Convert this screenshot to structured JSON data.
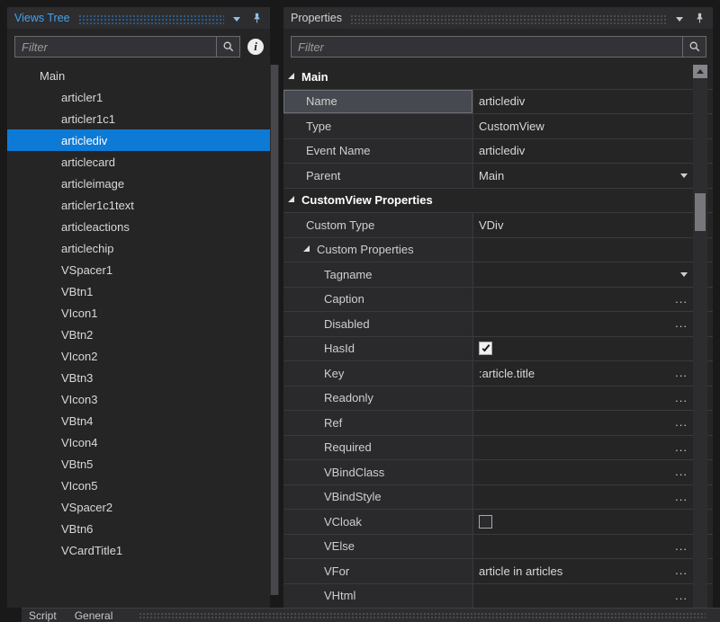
{
  "glyphs": {
    "ellipsis": "..."
  },
  "colors": {
    "selection_blue": "#0d7ad6",
    "active_title_blue": "#42a3ea",
    "panel_background": "#252526"
  },
  "views_tree": {
    "title": "Views Tree",
    "filter_placeholder": "Filter",
    "items": [
      {
        "label": "Main",
        "level": 0
      },
      {
        "label": "articler1",
        "level": 1
      },
      {
        "label": "articler1c1",
        "level": 1
      },
      {
        "label": "articlediv",
        "level": 1,
        "selected": true
      },
      {
        "label": "articlecard",
        "level": 1
      },
      {
        "label": "articleimage",
        "level": 1
      },
      {
        "label": "articler1c1text",
        "level": 1
      },
      {
        "label": "articleactions",
        "level": 1
      },
      {
        "label": "articlechip",
        "level": 1
      },
      {
        "label": "VSpacer1",
        "level": 1
      },
      {
        "label": "VBtn1",
        "level": 1
      },
      {
        "label": "VIcon1",
        "level": 1
      },
      {
        "label": "VBtn2",
        "level": 1
      },
      {
        "label": "VIcon2",
        "level": 1
      },
      {
        "label": "VBtn3",
        "level": 1
      },
      {
        "label": "VIcon3",
        "level": 1
      },
      {
        "label": "VBtn4",
        "level": 1
      },
      {
        "label": "VIcon4",
        "level": 1
      },
      {
        "label": "VBtn5",
        "level": 1
      },
      {
        "label": "VIcon5",
        "level": 1
      },
      {
        "label": "VSpacer2",
        "level": 1
      },
      {
        "label": "VBtn6",
        "level": 1
      },
      {
        "label": "VCardTitle1",
        "level": 1
      }
    ]
  },
  "properties": {
    "title": "Properties",
    "filter_placeholder": "Filter",
    "rows": [
      {
        "kind": "section",
        "label": "Main",
        "level": 0
      },
      {
        "kind": "prop",
        "label": "Name",
        "value": "articlediv",
        "level": 1,
        "selected": true
      },
      {
        "kind": "prop",
        "label": "Type",
        "value": "CustomView",
        "level": 1
      },
      {
        "kind": "prop",
        "label": "Event Name",
        "value": "articlediv",
        "level": 1
      },
      {
        "kind": "prop",
        "label": "Parent",
        "value": "Main",
        "level": 1,
        "control": "dropdown"
      },
      {
        "kind": "section",
        "label": "CustomView Properties",
        "level": 0
      },
      {
        "kind": "prop",
        "label": "Custom Type",
        "value": "VDiv",
        "level": 1
      },
      {
        "kind": "group",
        "label": "Custom Properties",
        "level": 1
      },
      {
        "kind": "prop",
        "label": "Tagname",
        "value": "",
        "level": 2,
        "control": "dropdown"
      },
      {
        "kind": "prop",
        "label": "Caption",
        "value": "",
        "level": 2,
        "control": "ellipsis"
      },
      {
        "kind": "prop",
        "label": "Disabled",
        "value": "",
        "level": 2,
        "control": "ellipsis"
      },
      {
        "kind": "prop",
        "label": "HasId",
        "value": "",
        "level": 2,
        "control": "checkbox",
        "checked": true
      },
      {
        "kind": "prop",
        "label": "Key",
        "value": ":article.title",
        "level": 2,
        "control": "ellipsis"
      },
      {
        "kind": "prop",
        "label": "Readonly",
        "value": "",
        "level": 2,
        "control": "ellipsis"
      },
      {
        "kind": "prop",
        "label": "Ref",
        "value": "",
        "level": 2,
        "control": "ellipsis"
      },
      {
        "kind": "prop",
        "label": "Required",
        "value": "",
        "level": 2,
        "control": "ellipsis"
      },
      {
        "kind": "prop",
        "label": "VBindClass",
        "value": "",
        "level": 2,
        "control": "ellipsis"
      },
      {
        "kind": "prop",
        "label": "VBindStyle",
        "value": "",
        "level": 2,
        "control": "ellipsis"
      },
      {
        "kind": "prop",
        "label": "VCloak",
        "value": "",
        "level": 2,
        "control": "checkbox",
        "checked": false
      },
      {
        "kind": "prop",
        "label": "VElse",
        "value": "",
        "level": 2,
        "control": "ellipsis"
      },
      {
        "kind": "prop",
        "label": "VFor",
        "value": "article in articles",
        "level": 2,
        "control": "ellipsis"
      },
      {
        "kind": "prop",
        "label": "VHtml",
        "value": "",
        "level": 2,
        "control": "ellipsis"
      }
    ]
  },
  "bottom_bar": {
    "tabs": [
      "Script",
      "General"
    ]
  }
}
